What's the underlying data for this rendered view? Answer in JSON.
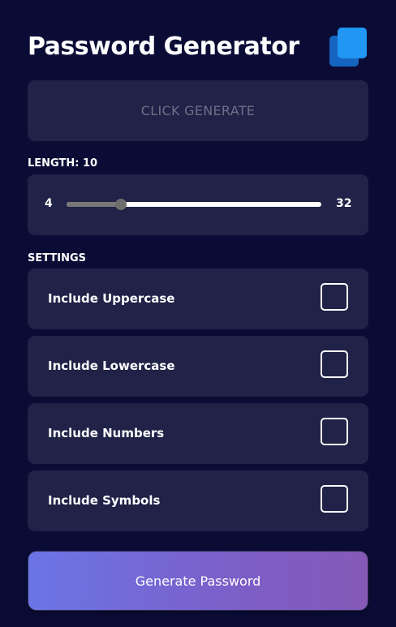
{
  "header": {
    "title": "Password Generator",
    "copy_icon": "copy-icon"
  },
  "result": {
    "text": "CLICK GENERATE"
  },
  "length": {
    "label": "LENGTH: 10",
    "min": "4",
    "max": "32",
    "value": 10
  },
  "settings": {
    "label": "SETTINGS",
    "items": [
      {
        "label": "Include Uppercase",
        "checked": false
      },
      {
        "label": "Include Lowercase",
        "checked": false
      },
      {
        "label": "Include Numbers",
        "checked": false
      },
      {
        "label": "Include Symbols",
        "checked": false
      }
    ]
  },
  "generate_button": {
    "label": "Generate Password"
  },
  "colors": {
    "background": "#0b0c36",
    "panel": "#202247",
    "button_gradient_start": "#6b75e6",
    "button_gradient_end": "#8559b8",
    "copy_icon_front": "#2196f3",
    "copy_icon_back": "#1565c0"
  }
}
